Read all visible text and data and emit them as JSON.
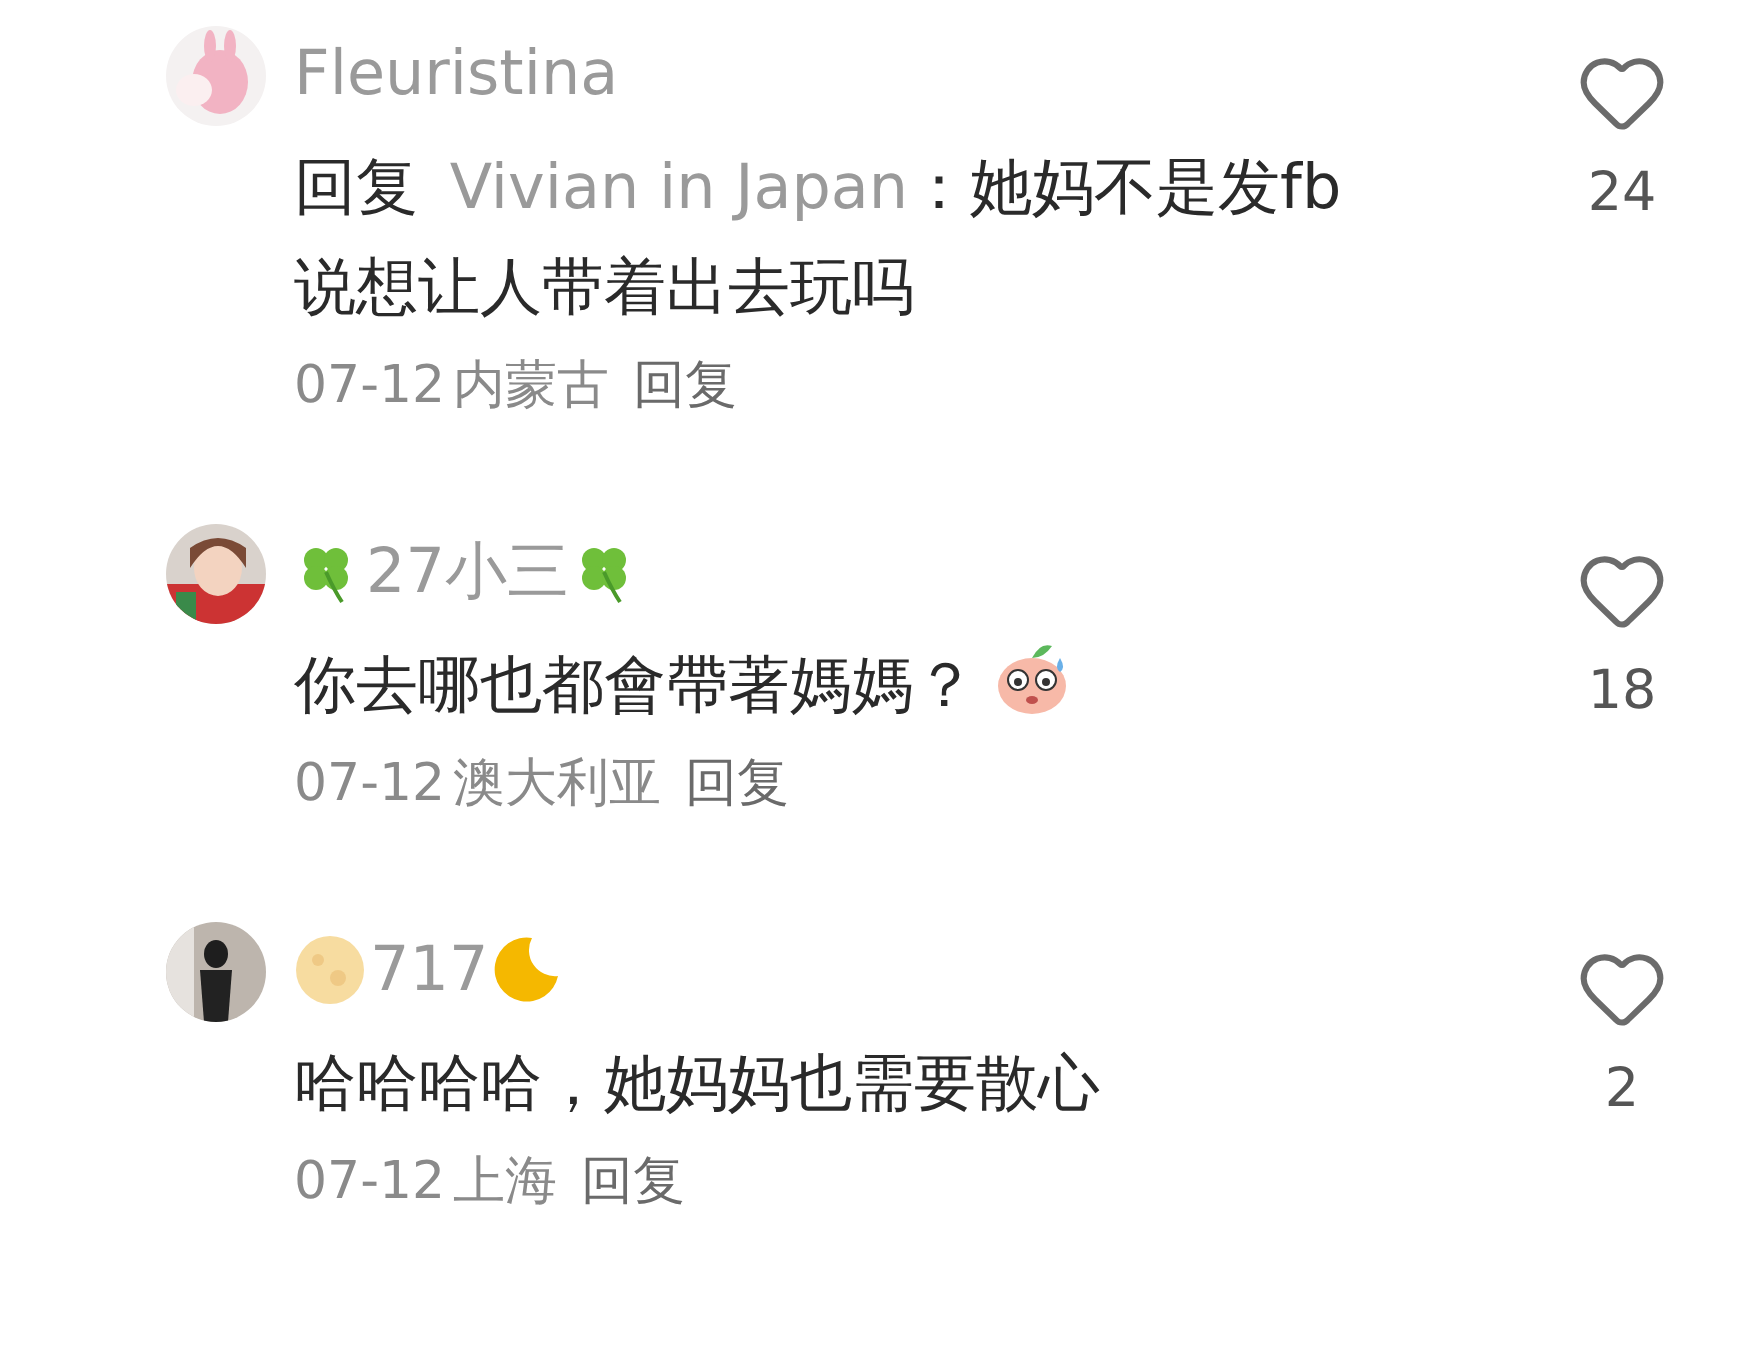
{
  "comments": [
    {
      "avatar": {
        "kind": "picture"
      },
      "name": [
        {
          "kind": "text",
          "text": "Fleuristina"
        }
      ],
      "body": [
        {
          "kind": "text",
          "text": "回复 "
        },
        {
          "kind": "mention",
          "text": "Vivian in Japan"
        },
        {
          "kind": "text",
          "text": "：她妈不是发fb说想让人带着出去玩吗"
        }
      ],
      "date": "07-12",
      "location": "内蒙古",
      "reply": "回复",
      "liked": false,
      "likes": "24"
    },
    {
      "avatar": {
        "kind": "picture"
      },
      "name": [
        {
          "kind": "clover"
        },
        {
          "kind": "text",
          "text": "27小三"
        },
        {
          "kind": "clover"
        }
      ],
      "body": [
        {
          "kind": "text",
          "text": "你去哪也都會帶著媽媽？"
        },
        {
          "kind": "peach"
        }
      ],
      "date": "07-12",
      "location": "澳大利亚",
      "reply": "回复",
      "liked": false,
      "likes": "18"
    },
    {
      "avatar": {
        "kind": "picture"
      },
      "name": [
        {
          "kind": "fullmoon"
        },
        {
          "kind": "text",
          "text": "717"
        },
        {
          "kind": "crescent"
        }
      ],
      "body": [
        {
          "kind": "text",
          "text": "哈哈哈哈，她妈妈也需要散心"
        }
      ],
      "date": "07-12",
      "location": "上海",
      "reply": "回复",
      "liked": false,
      "likes": "2"
    }
  ]
}
